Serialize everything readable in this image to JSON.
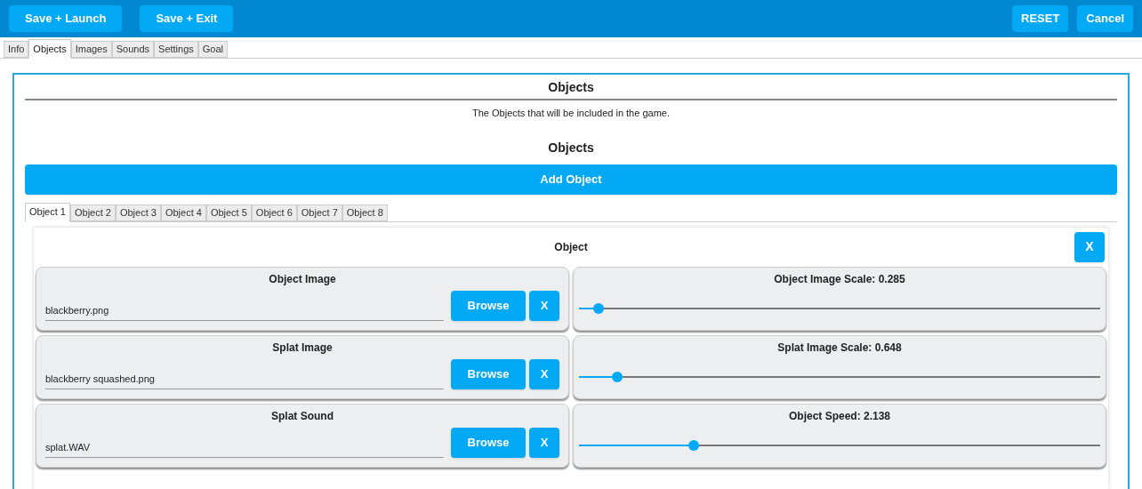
{
  "toolbar": {
    "left_buttons": [
      "Save + Launch",
      "Save + Exit"
    ],
    "right_buttons": [
      "RESET",
      "Cancel"
    ]
  },
  "tabs": [
    {
      "label": "Info",
      "selected": false
    },
    {
      "label": "Objects",
      "selected": true
    },
    {
      "label": "Images",
      "selected": false
    },
    {
      "label": "Sounds",
      "selected": false
    },
    {
      "label": "Settings",
      "selected": false
    },
    {
      "label": "Goal",
      "selected": false
    }
  ],
  "section": {
    "title": "Objects",
    "description": "The Objects that will be included in the game.",
    "subtitle": "Objects",
    "add_button": "Add Object",
    "object_tabs": [
      {
        "label": "Object 1",
        "selected": true
      },
      {
        "label": "Object 2",
        "selected": false
      },
      {
        "label": "Object 3",
        "selected": false
      },
      {
        "label": "Object 4",
        "selected": false
      },
      {
        "label": "Object 5",
        "selected": false
      },
      {
        "label": "Object 6",
        "selected": false
      },
      {
        "label": "Object 7",
        "selected": false
      },
      {
        "label": "Object 8",
        "selected": false
      }
    ],
    "object": {
      "title": "Object",
      "close_button": "X",
      "file_fields": [
        {
          "label": "Object Image",
          "value": "blackberry.png",
          "browse_button": "Browse",
          "clear_button": "X"
        },
        {
          "label": "Splat Image",
          "value": "blackberry squashed.png",
          "browse_button": "Browse",
          "clear_button": "X"
        },
        {
          "label": "Splat Sound",
          "value": "splat.WAV",
          "browse_button": "Browse",
          "clear_button": "X"
        }
      ],
      "sliders": [
        {
          "label": "Object Image Scale: 0.285",
          "level": 0.037
        },
        {
          "label": "Splat Image Scale: 0.648",
          "level": 0.074
        },
        {
          "label": "Object Speed: 2.138",
          "level": 0.22
        }
      ]
    }
  }
}
